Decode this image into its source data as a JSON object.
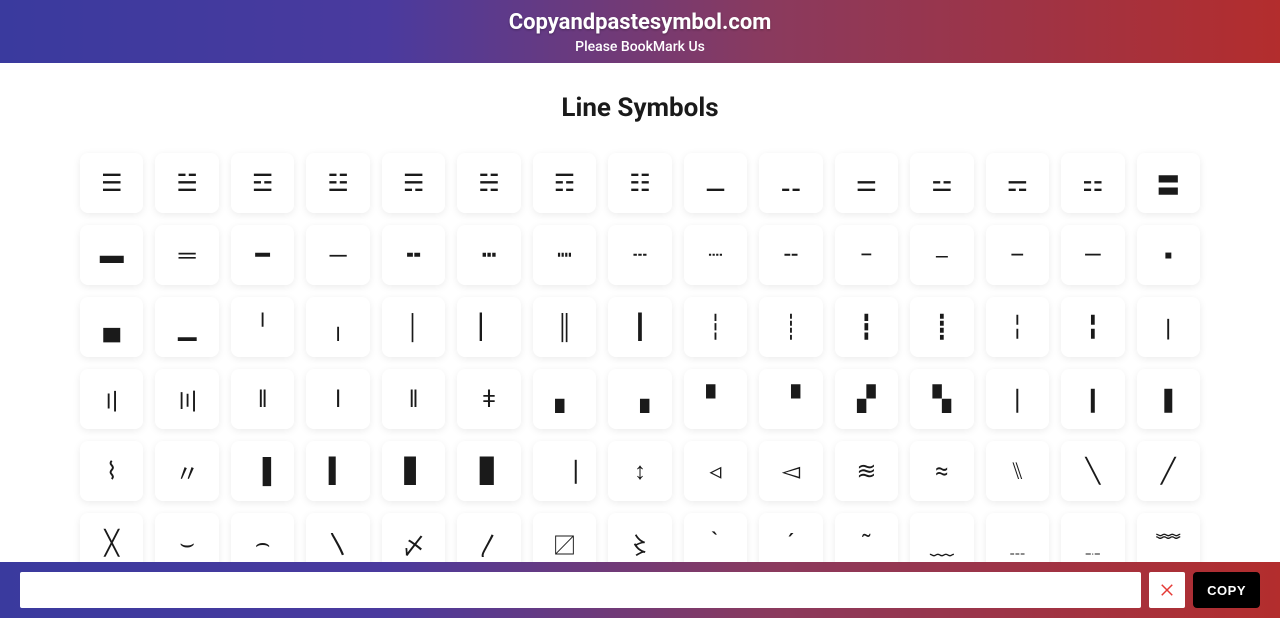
{
  "header": {
    "site_title": "Copyandpastesymbol.com",
    "bookmark_text": "Please BookMark Us"
  },
  "main": {
    "page_title": "Line Symbols",
    "symbols": [
      "☰",
      "☱",
      "☲",
      "☳",
      "☴",
      "☵",
      "☶",
      "☷",
      "⚊",
      "⚋",
      "⚌",
      "⚍",
      "⚎",
      "⚏",
      "〓",
      "▬",
      "═",
      "━",
      "─",
      "╍",
      "┅",
      "┉",
      "┄",
      "┈",
      "╌",
      "−",
      "⎯",
      "–",
      "—",
      "▪",
      "▄",
      "▁",
      "╵",
      "╷",
      "│",
      "▏",
      "║",
      "┃",
      "┆",
      "┊",
      "┇",
      "┋",
      "╎",
      "╏",
      "〡",
      "〢",
      "〣",
      "‖",
      "ǀ",
      "ǁ",
      "ǂ",
      "▖",
      "▗",
      "▘",
      "▝",
      "▞",
      "▚",
      "❘",
      "❙",
      "❚",
      "⌇",
      "〃",
      "▐",
      "▍",
      "▋",
      "▊",
      "⎹",
      "↕",
      "◃",
      "◅",
      "≋",
      "≈",
      "⑊",
      "╲",
      "╱",
      "╳",
      "⌣",
      "⌢",
      "〵",
      "〆",
      "〳",
      "〼",
      "〻",
      "｀",
      "´",
      "῀",
      "﹏",
      "﹍",
      "﹎",
      "﹌"
    ]
  },
  "bottom_bar": {
    "input_value": "",
    "input_placeholder": "",
    "copy_label": "COPY"
  }
}
